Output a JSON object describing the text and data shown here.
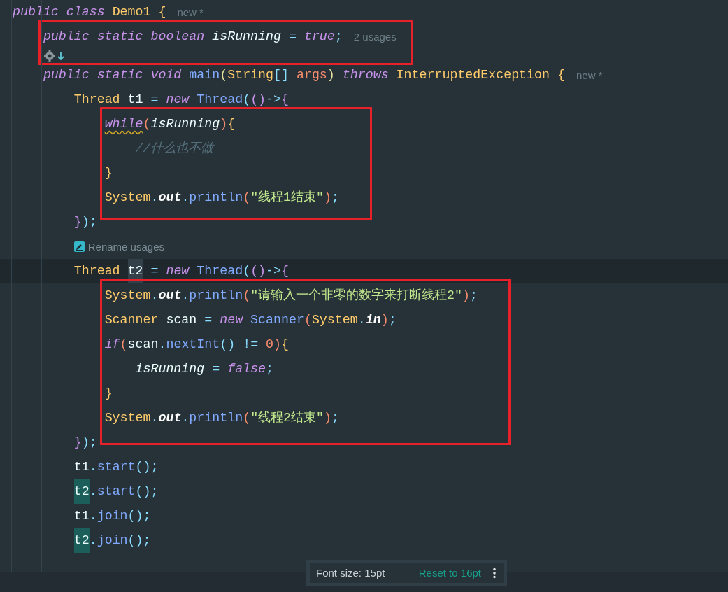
{
  "code": [
    {
      "kind": "code",
      "current": false,
      "hint": "new *",
      "tokens": [
        {
          "text": "public class ",
          "kind": "kw"
        },
        {
          "text": "Demo1",
          "kind": "type"
        },
        {
          "text": " {",
          "kind": "brace"
        }
      ],
      "children": [
        {
          "kind": "frame",
          "children": [
            {
              "kind": "code",
              "current": false,
              "hint": "2 usages",
              "tokens": [
                {
                  "text": "public static boolean ",
                  "kind": "kw"
                },
                {
                  "text": "isRunning",
                  "kind": "field"
                },
                {
                  "text": " = ",
                  "kind": "punct"
                },
                {
                  "text": "true",
                  "kind": "kw"
                },
                {
                  "text": ";",
                  "kind": "punct"
                }
              ]
            },
            {
              "kind": "gutter_hint"
            }
          ]
        },
        {
          "kind": "code",
          "current": false,
          "hint": "new *",
          "tokens": [
            {
              "text": "public static void ",
              "kind": "kw"
            },
            {
              "text": "main",
              "kind": "fn"
            },
            {
              "text": "(",
              "kind": "paren2"
            },
            {
              "text": "String",
              "kind": "type"
            },
            {
              "text": "[]",
              "kind": "punct"
            },
            {
              "text": " args",
              "kind": "param"
            },
            {
              "text": ")",
              "kind": "paren2"
            },
            {
              "text": " throws ",
              "kind": "kw"
            },
            {
              "text": "InterruptedException",
              "kind": "type"
            },
            {
              "text": " {",
              "kind": "brace"
            }
          ],
          "children": [
            {
              "kind": "code",
              "current": false,
              "tokens": [
                {
                  "text": "Thread ",
                  "kind": "type"
                },
                {
                  "text": "t1 ",
                  "kind": "plain"
                },
                {
                  "text": "= ",
                  "kind": "punct"
                },
                {
                  "text": "new ",
                  "kind": "kw"
                },
                {
                  "text": "Thread",
                  "kind": "fn"
                },
                {
                  "text": "(",
                  "kind": "punct"
                },
                {
                  "text": "()",
                  "kind": "bracket2"
                },
                {
                  "text": "->",
                  "kind": "punct"
                },
                {
                  "text": "{",
                  "kind": "bracket2"
                }
              ],
              "children": [
                {
                  "kind": "frame",
                  "children": [
                    {
                      "kind": "code",
                      "current": false,
                      "tokens": [
                        {
                          "text": "while",
                          "kind": "kw",
                          "warning": true
                        },
                        {
                          "text": "(",
                          "kind": "paren"
                        },
                        {
                          "text": "isRunning",
                          "kind": "field"
                        },
                        {
                          "text": ")",
                          "kind": "paren"
                        },
                        {
                          "text": "{",
                          "kind": "brace"
                        }
                      ],
                      "children": [
                        {
                          "kind": "code",
                          "current": false,
                          "tokens": [
                            {
                              "text": "//什么也不做",
                              "kind": "comment"
                            }
                          ]
                        }
                      ]
                    },
                    {
                      "kind": "code",
                      "current": false,
                      "tokens": [
                        {
                          "text": "}",
                          "kind": "brace"
                        }
                      ]
                    },
                    {
                      "kind": "code",
                      "current": false,
                      "tokens": [
                        {
                          "text": "System",
                          "kind": "type"
                        },
                        {
                          "text": ".",
                          "kind": "punct"
                        },
                        {
                          "text": "out",
                          "kind": "static"
                        },
                        {
                          "text": ".",
                          "kind": "punct"
                        },
                        {
                          "text": "println",
                          "kind": "fn"
                        },
                        {
                          "text": "(",
                          "kind": "paren"
                        },
                        {
                          "text": "\"线程1结束\"",
                          "kind": "str"
                        },
                        {
                          "text": ")",
                          "kind": "paren"
                        },
                        {
                          "text": ";",
                          "kind": "punct"
                        }
                      ]
                    }
                  ]
                }
              ]
            },
            {
              "kind": "code",
              "current": false,
              "tokens": [
                {
                  "text": "}",
                  "kind": "bracket2"
                },
                {
                  "text": ");",
                  "kind": "punct"
                }
              ]
            },
            {
              "kind": "rename_hint",
              "current": false,
              "label": "Rename usages"
            },
            {
              "kind": "code",
              "current": true,
              "tokens": [
                {
                  "text": "Thread ",
                  "kind": "type"
                },
                {
                  "text": "t2",
                  "kind": "plain",
                  "at_caret": true
                },
                {
                  "text": " = ",
                  "kind": "punct"
                },
                {
                  "text": "new ",
                  "kind": "kw"
                },
                {
                  "text": "Thread",
                  "kind": "fn"
                },
                {
                  "text": "(",
                  "kind": "punct"
                },
                {
                  "text": "()",
                  "kind": "bracket2"
                },
                {
                  "text": "->",
                  "kind": "punct"
                },
                {
                  "text": "{",
                  "kind": "bracket2"
                }
              ],
              "children": [
                {
                  "kind": "frame",
                  "children": [
                    {
                      "kind": "code",
                      "current": false,
                      "tokens": [
                        {
                          "text": "System",
                          "kind": "type"
                        },
                        {
                          "text": ".",
                          "kind": "punct"
                        },
                        {
                          "text": "out",
                          "kind": "static"
                        },
                        {
                          "text": ".",
                          "kind": "punct"
                        },
                        {
                          "text": "println",
                          "kind": "fn"
                        },
                        {
                          "text": "(",
                          "kind": "paren"
                        },
                        {
                          "text": "\"请输入一个非零的数字来打断线程2\"",
                          "kind": "str"
                        },
                        {
                          "text": ")",
                          "kind": "paren"
                        },
                        {
                          "text": ";",
                          "kind": "punct"
                        }
                      ]
                    },
                    {
                      "kind": "code",
                      "current": false,
                      "tokens": [
                        {
                          "text": "Scanner ",
                          "kind": "type"
                        },
                        {
                          "text": "scan ",
                          "kind": "plain"
                        },
                        {
                          "text": "= ",
                          "kind": "punct"
                        },
                        {
                          "text": "new ",
                          "kind": "kw"
                        },
                        {
                          "text": "Scanner",
                          "kind": "fn"
                        },
                        {
                          "text": "(",
                          "kind": "paren"
                        },
                        {
                          "text": "System",
                          "kind": "type"
                        },
                        {
                          "text": ".",
                          "kind": "punct"
                        },
                        {
                          "text": "in",
                          "kind": "static"
                        },
                        {
                          "text": ")",
                          "kind": "paren"
                        },
                        {
                          "text": ";",
                          "kind": "punct"
                        }
                      ]
                    },
                    {
                      "kind": "code",
                      "current": false,
                      "tokens": [
                        {
                          "text": "if",
                          "kind": "kw"
                        },
                        {
                          "text": "(",
                          "kind": "paren"
                        },
                        {
                          "text": "scan",
                          "kind": "plain"
                        },
                        {
                          "text": ".",
                          "kind": "punct"
                        },
                        {
                          "text": "nextInt",
                          "kind": "fn"
                        },
                        {
                          "text": "() != ",
                          "kind": "punct"
                        },
                        {
                          "text": "0",
                          "kind": "num"
                        },
                        {
                          "text": ")",
                          "kind": "paren"
                        },
                        {
                          "text": "{",
                          "kind": "brace"
                        }
                      ],
                      "children": [
                        {
                          "kind": "code",
                          "current": false,
                          "tokens": [
                            {
                              "text": "isRunning",
                              "kind": "field"
                            },
                            {
                              "text": " = ",
                              "kind": "punct"
                            },
                            {
                              "text": "false",
                              "kind": "kw"
                            },
                            {
                              "text": ";",
                              "kind": "punct"
                            }
                          ]
                        }
                      ]
                    },
                    {
                      "kind": "code",
                      "current": false,
                      "tokens": [
                        {
                          "text": "}",
                          "kind": "brace"
                        }
                      ]
                    },
                    {
                      "kind": "code",
                      "current": false,
                      "tokens": [
                        {
                          "text": "System",
                          "kind": "type"
                        },
                        {
                          "text": ".",
                          "kind": "punct"
                        },
                        {
                          "text": "out",
                          "kind": "static"
                        },
                        {
                          "text": ".",
                          "kind": "punct"
                        },
                        {
                          "text": "println",
                          "kind": "fn"
                        },
                        {
                          "text": "(",
                          "kind": "paren"
                        },
                        {
                          "text": "\"线程2结束\"",
                          "kind": "str"
                        },
                        {
                          "text": ")",
                          "kind": "paren"
                        },
                        {
                          "text": ";",
                          "kind": "punct"
                        }
                      ]
                    }
                  ]
                }
              ]
            },
            {
              "kind": "code",
              "current": false,
              "tokens": [
                {
                  "text": "}",
                  "kind": "bracket2"
                },
                {
                  "text": ");",
                  "kind": "punct"
                }
              ]
            },
            {
              "kind": "code",
              "current": false,
              "tokens": [
                {
                  "text": "t1",
                  "kind": "plain"
                },
                {
                  "text": ".",
                  "kind": "punct"
                },
                {
                  "text": "start",
                  "kind": "fn"
                },
                {
                  "text": "();",
                  "kind": "punct"
                }
              ]
            },
            {
              "kind": "code",
              "current": false,
              "tokens": [
                {
                  "text": "t2",
                  "kind": "plain",
                  "usage_highlight": true
                },
                {
                  "text": ".",
                  "kind": "punct"
                },
                {
                  "text": "start",
                  "kind": "fn"
                },
                {
                  "text": "();",
                  "kind": "punct"
                }
              ]
            },
            {
              "kind": "code",
              "current": false,
              "tokens": [
                {
                  "text": "t1",
                  "kind": "plain"
                },
                {
                  "text": ".",
                  "kind": "punct"
                },
                {
                  "text": "join",
                  "kind": "fn"
                },
                {
                  "text": "();",
                  "kind": "punct"
                }
              ]
            },
            {
              "kind": "code",
              "current": false,
              "tokens": [
                {
                  "text": "t2",
                  "kind": "plain",
                  "usage_highlight": true
                },
                {
                  "text": ".",
                  "kind": "punct"
                },
                {
                  "text": "join",
                  "kind": "fn"
                },
                {
                  "text": "();",
                  "kind": "punct"
                }
              ]
            }
          ]
        }
      ]
    }
  ],
  "font_popup": {
    "label": "Font size: 15pt",
    "reset_link": "Reset to 16pt"
  }
}
